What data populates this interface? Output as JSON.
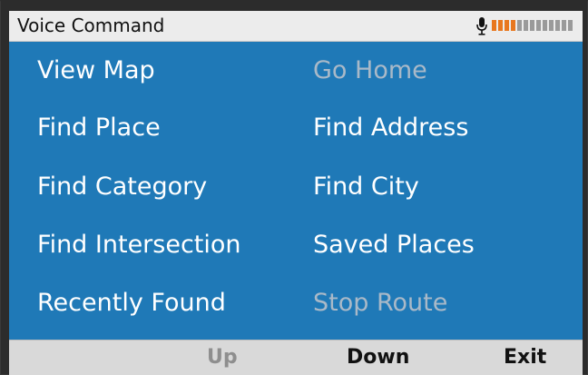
{
  "title_bar": {
    "title": "Voice Command",
    "mic_icon": "microphone-icon",
    "level_meter": {
      "level": 0.3,
      "segments": 13,
      "active_color": "#e8771f",
      "inactive_color": "#9a9a9a"
    }
  },
  "menu": {
    "left": [
      {
        "label": "View Map",
        "enabled": true
      },
      {
        "label": "Find Place",
        "enabled": true
      },
      {
        "label": "Find Category",
        "enabled": true
      },
      {
        "label": "Find Intersection",
        "enabled": true
      },
      {
        "label": "Recently Found",
        "enabled": true
      }
    ],
    "right": [
      {
        "label": "Go Home",
        "enabled": false
      },
      {
        "label": "Find Address",
        "enabled": true
      },
      {
        "label": "Find City",
        "enabled": true
      },
      {
        "label": "Saved Places",
        "enabled": true
      },
      {
        "label": "Stop Route",
        "enabled": false
      }
    ]
  },
  "soft_keys": [
    {
      "label": "Up",
      "enabled": false
    },
    {
      "label": "Down",
      "enabled": true
    },
    {
      "label": "Exit",
      "enabled": true
    }
  ],
  "colors": {
    "screen_background": "#1f79b7",
    "enabled_text": "#ffffff",
    "disabled_text": "#a9b9c8",
    "title_background": "#ececec",
    "softkey_background": "#d9d9d9"
  }
}
